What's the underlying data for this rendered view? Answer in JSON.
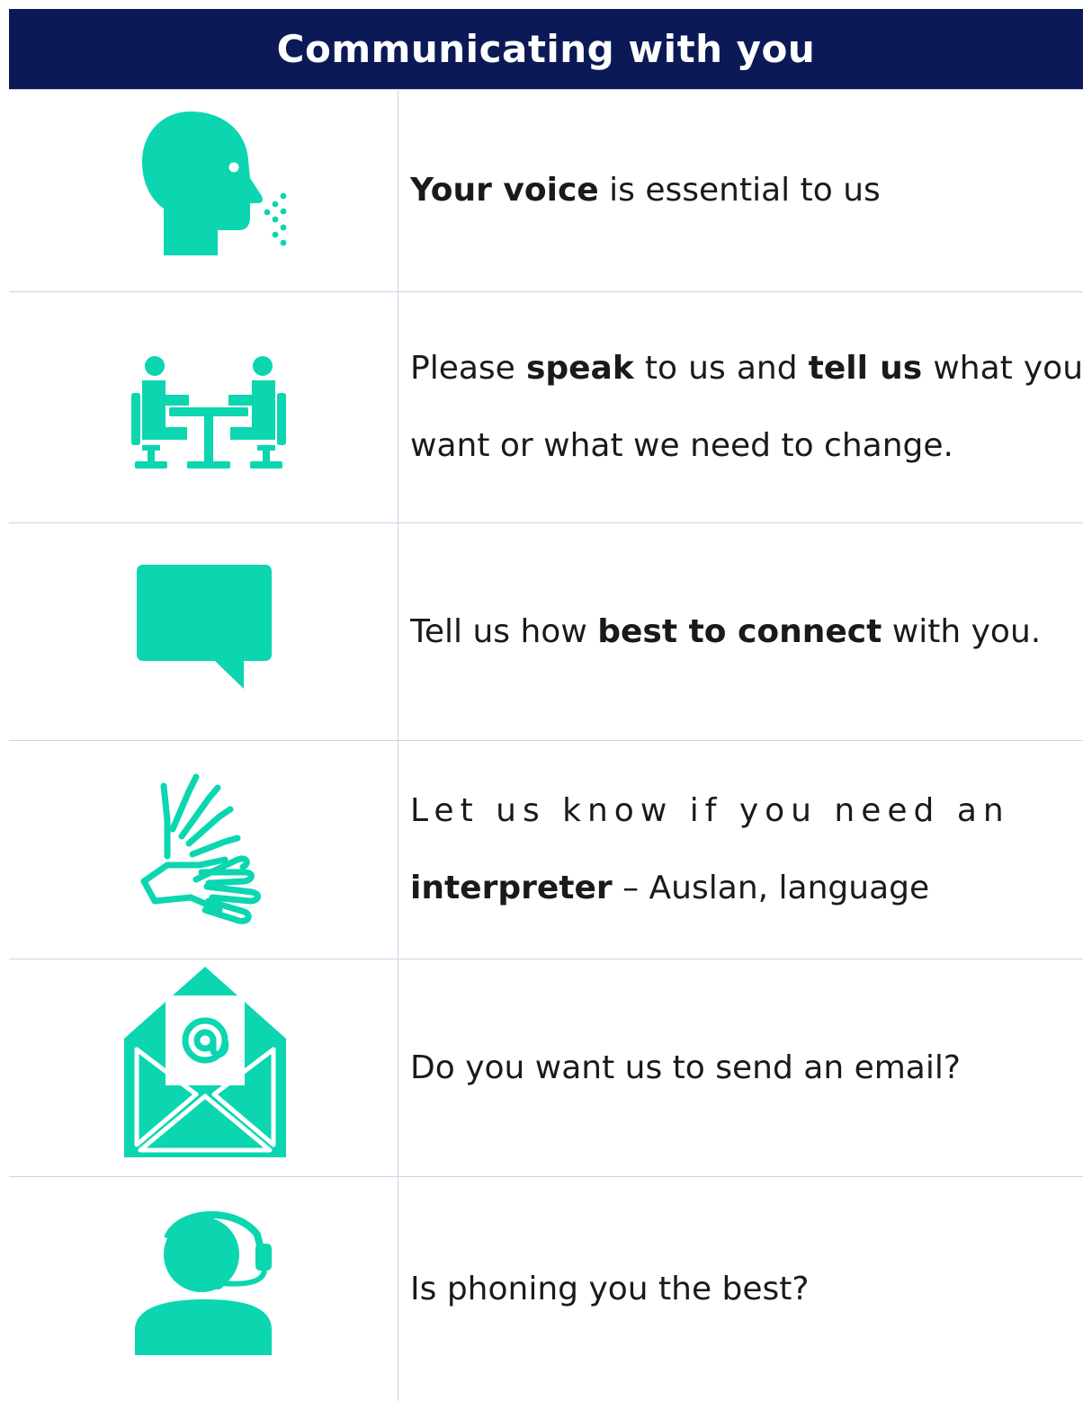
{
  "header": {
    "title": "Communicating with you"
  },
  "colors": {
    "header_bg": "#0b1a57",
    "icon": "#0bd6b0",
    "rule": "#c9d6e6"
  },
  "rows": [
    {
      "icon": "speaking-head-icon",
      "bold": "Your voice",
      "rest": " is essential to us"
    },
    {
      "icon": "meeting-table-icon",
      "pre": "Please ",
      "b1": "speak",
      "mid": " to us and ",
      "b2": "tell us",
      "post": " what you want or what we need to change."
    },
    {
      "icon": "speech-bubble-icon",
      "pre": "Tell us how ",
      "bold": "best to connect",
      "post": " with you."
    },
    {
      "icon": "sign-language-hands-icon",
      "line1": "Let us know if you need an",
      "bold": "interpreter",
      "rest": " – Auslan, language"
    },
    {
      "icon": "email-envelope-icon",
      "text": "Do you want us to send an email?"
    },
    {
      "icon": "headset-person-icon",
      "text": "Is phoning you the best?"
    }
  ]
}
